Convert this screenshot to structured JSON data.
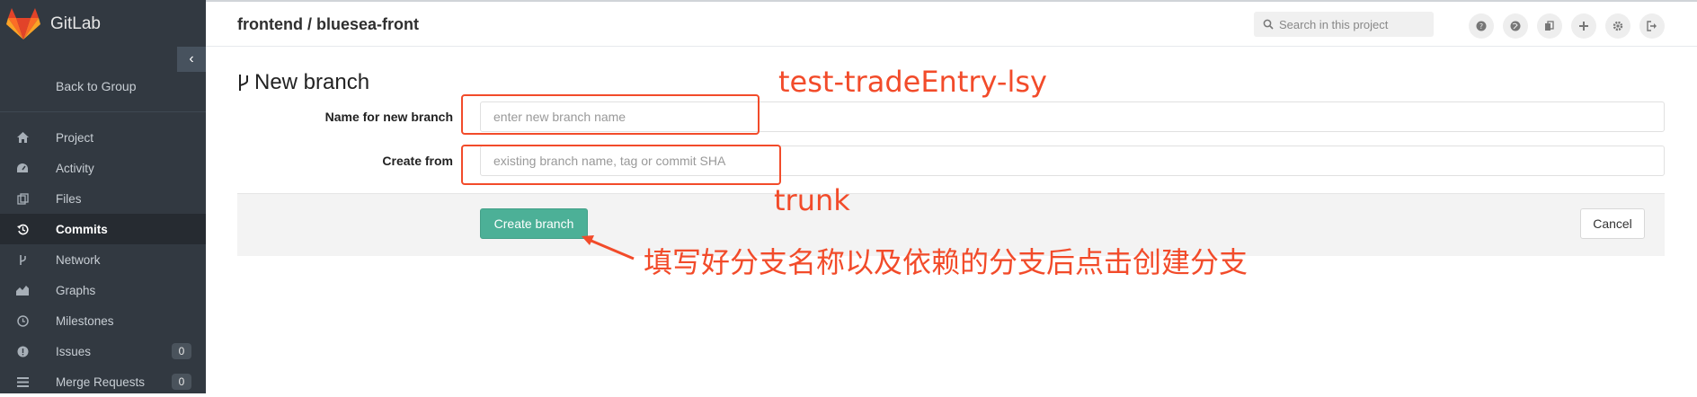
{
  "app": {
    "name": "GitLab"
  },
  "sidebar": {
    "collapse_icon": "‹",
    "back_label": "Back to Group",
    "items": [
      {
        "label": "Project",
        "icon": "home-icon",
        "active": false,
        "count": ""
      },
      {
        "label": "Activity",
        "icon": "dashboard-icon",
        "active": false,
        "count": ""
      },
      {
        "label": "Files",
        "icon": "files-icon",
        "active": false,
        "count": ""
      },
      {
        "label": "Commits",
        "icon": "history-icon",
        "active": true,
        "count": ""
      },
      {
        "label": "Network",
        "icon": "branch-icon",
        "active": false,
        "count": ""
      },
      {
        "label": "Graphs",
        "icon": "graph-icon",
        "active": false,
        "count": ""
      },
      {
        "label": "Milestones",
        "icon": "clock-icon",
        "active": false,
        "count": ""
      },
      {
        "label": "Issues",
        "icon": "exclamation-icon",
        "active": false,
        "count": "0"
      },
      {
        "label": "Merge Requests",
        "icon": "list-icon",
        "active": false,
        "count": "0"
      }
    ]
  },
  "header": {
    "breadcrumb": "frontend / bluesea-front",
    "search_placeholder": "Search in this project",
    "icons": [
      "help-icon",
      "explore-icon",
      "snippets-icon",
      "new-project-icon",
      "settings-icon",
      "sign-out-icon"
    ]
  },
  "page": {
    "title": "New branch",
    "fields": {
      "name_label": "Name for new branch",
      "name_placeholder": "enter new branch name",
      "ref_label": "Create from",
      "ref_placeholder": "existing branch name, tag or commit SHA"
    },
    "create_button": "Create branch",
    "cancel_button": "Cancel"
  },
  "annotations": {
    "name_hint": "test-tradeEntry-lsy",
    "ref_hint": "trunk",
    "instruction": "填写好分支名称以及依赖的分支后点击创建分支",
    "color": "#f24b2a"
  },
  "colors": {
    "sidebar_bg": "#323941",
    "active_item_bg": "#262b31",
    "primary_button": "#4cb097"
  }
}
